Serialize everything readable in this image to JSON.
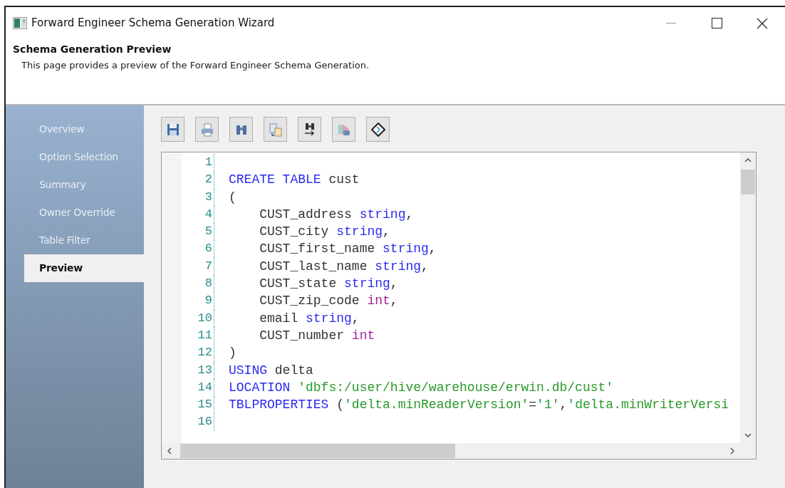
{
  "window": {
    "title": "Forward Engineer Schema Generation Wizard"
  },
  "header": {
    "title": "Schema Generation Preview",
    "description": "This page provides a preview of the Forward Engineer Schema Generation."
  },
  "sidebar": {
    "items": [
      {
        "label": "Overview",
        "selected": false
      },
      {
        "label": "Option Selection",
        "selected": false
      },
      {
        "label": "Summary",
        "selected": false
      },
      {
        "label": "Owner Override",
        "selected": false
      },
      {
        "label": "Table Filter",
        "selected": false
      },
      {
        "label": "Preview",
        "selected": true
      }
    ]
  },
  "editor": {
    "lines": [
      {
        "number": "1"
      },
      {
        "number": "2",
        "tokens": [
          {
            "kind": "keyword",
            "text": "CREATE TABLE"
          },
          {
            "kind": "plain",
            "text": " cust"
          }
        ]
      },
      {
        "number": "3",
        "tokens": [
          {
            "kind": "plain",
            "text": "("
          }
        ]
      },
      {
        "number": "4",
        "tokens": [
          {
            "kind": "plain",
            "text": "    CUST_address "
          },
          {
            "kind": "type",
            "text": "string"
          },
          {
            "kind": "plain",
            "text": ","
          }
        ]
      },
      {
        "number": "5",
        "tokens": [
          {
            "kind": "plain",
            "text": "    CUST_city "
          },
          {
            "kind": "type",
            "text": "string"
          },
          {
            "kind": "plain",
            "text": ","
          }
        ]
      },
      {
        "number": "6",
        "tokens": [
          {
            "kind": "plain",
            "text": "    CUST_first_name "
          },
          {
            "kind": "type",
            "text": "string"
          },
          {
            "kind": "plain",
            "text": ","
          }
        ]
      },
      {
        "number": "7",
        "tokens": [
          {
            "kind": "plain",
            "text": "    CUST_last_name "
          },
          {
            "kind": "type",
            "text": "string"
          },
          {
            "kind": "plain",
            "text": ","
          }
        ]
      },
      {
        "number": "8",
        "tokens": [
          {
            "kind": "plain",
            "text": "    CUST_state "
          },
          {
            "kind": "type",
            "text": "string"
          },
          {
            "kind": "plain",
            "text": ","
          }
        ]
      },
      {
        "number": "9",
        "tokens": [
          {
            "kind": "plain",
            "text": "    CUST_zip_code "
          },
          {
            "kind": "number_type",
            "text": "int"
          },
          {
            "kind": "plain",
            "text": ","
          }
        ]
      },
      {
        "number": "10",
        "tokens": [
          {
            "kind": "plain",
            "text": "    email "
          },
          {
            "kind": "type",
            "text": "string"
          },
          {
            "kind": "plain",
            "text": ","
          }
        ]
      },
      {
        "number": "11",
        "tokens": [
          {
            "kind": "plain",
            "text": "    CUST_number "
          },
          {
            "kind": "number_type",
            "text": "int"
          }
        ]
      },
      {
        "number": "12",
        "tokens": [
          {
            "kind": "plain",
            "text": ")"
          }
        ]
      },
      {
        "number": "13",
        "tokens": [
          {
            "kind": "keyword",
            "text": "USING"
          },
          {
            "kind": "plain",
            "text": " delta"
          }
        ]
      },
      {
        "number": "14",
        "tokens": [
          {
            "kind": "keyword",
            "text": "LOCATION "
          },
          {
            "kind": "string",
            "text": "'dbfs:/user/hive/warehouse/erwin.db/cust'"
          }
        ]
      },
      {
        "number": "15",
        "tokens": [
          {
            "kind": "keyword",
            "text": "TBLPROPERTIES"
          },
          {
            "kind": "plain",
            "text": " ("
          },
          {
            "kind": "string",
            "text": "'delta.minReaderVersion'"
          },
          {
            "kind": "plain",
            "text": "="
          },
          {
            "kind": "string",
            "text": "'1'"
          },
          {
            "kind": "plain",
            "text": ","
          },
          {
            "kind": "string",
            "text": "'delta.minWriterVersi"
          }
        ]
      },
      {
        "number": "16"
      }
    ]
  }
}
